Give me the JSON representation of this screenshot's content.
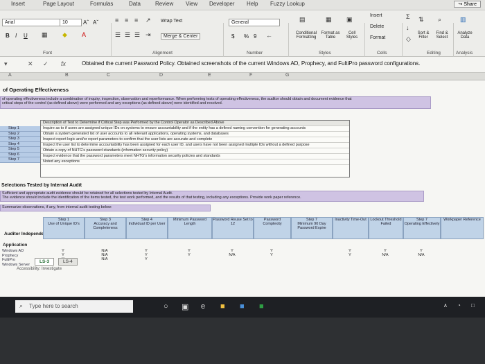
{
  "menubar": {
    "tabs": [
      "Insert",
      "Page Layout",
      "Formulas",
      "Data",
      "Review",
      "View",
      "Developer",
      "Help",
      "Fuzzy Lookup"
    ],
    "share": "Share"
  },
  "ribbon": {
    "font_name": "Arial",
    "font_size": "10",
    "font_grow": "Aˆ",
    "font_shrink": "Aˇ",
    "bold": "B",
    "italic": "I",
    "underline": "U",
    "wrap_text": "Wrap Text",
    "merge_center": "Merge & Center",
    "number_format": "General",
    "currency": "$",
    "percent": "%",
    "comma": "9",
    "conditional_formatting": "Conditional Formatting",
    "format_as_table": "Format as Table",
    "cell_styles": "Cell Styles",
    "insert": "Insert",
    "delete": "Delete",
    "format": "Format",
    "sort_filter": "Sort & Filter",
    "find_select": "Find & Select",
    "analyze_data": "Analyze Data",
    "groups": {
      "font": "Font",
      "alignment": "Alignment",
      "number": "Number",
      "styles": "Styles",
      "cells": "Cells",
      "editing": "Editing",
      "analysis": "Analysis"
    }
  },
  "formula_bar": {
    "fx": "fx",
    "text": "Obtained the current Password Policy. Obtained screenshots of the current Windows AD, Prophecy, and FultiPro password configurations."
  },
  "columns": [
    "A",
    "B",
    "C",
    "D",
    "E",
    "F",
    "G"
  ],
  "sheet": {
    "title": "of Operating Effectiveness",
    "intro": "of operating effectiveness include a combination of inquiry, inspection, observation and reperformance. When performing tests of operating effectiveness, the auditor should obtain and document evidence that",
    "intro2": "critical steps of the control (as defined above) were performed and any exceptions (as defined above) were identified and resolved.",
    "description_header": "Description of Test to Determine if Critical Step was Performed by the Control Operator as Described Above",
    "descriptions": [
      "Inquire as to if users are assigned unique IDs on systems to ensure accountability and if the entity has a defined naming convention for generating accounts",
      "Obtain a system generated list of user accounts to all relevant applications, operating systems, and databases",
      "Inspect report logic and/or report parameters to confirm that the user lists are accurate and complete",
      "Inspect the user list to determine accountability has been assigned for each user ID, and users have not been assigned multiple IDs without a defined purpose",
      "Obtain a copy of NHTG's password standards (information security policy)",
      "Inspect evidence that the password parameters meet NHTG's information security policies and standards",
      "Noted any exceptions"
    ],
    "steps": [
      "Step 1",
      "Step 2",
      "Step 3",
      "Step 4",
      "Step 5",
      "Step 6",
      "Step 7"
    ],
    "selections_title": "Selections Tested by Internal Audit",
    "selections_text1": "Sufficient and appropriate audit evidence should be retained for all selections tested by Internal Audit.",
    "selections_text2": "The evidence should include the identification of the items tested, the test work performed, and the results of that testing, including any exceptions. Provide work paper reference.",
    "summarize": "Summarize observations, if any, from internal audit testing below:",
    "table_title": "Auditor Independent Testing",
    "table_headers": [
      "Application",
      "Use of Unique ID's",
      "Accuracy and Completeness",
      "Individual ID per User",
      "Minimum Password Length",
      "Password Reuse Set to 12",
      "Password Complexity",
      "Minimum 90 Day Password Expire",
      "Inactivity Time-Out",
      "Lockout Threshold Failed",
      "Operating Effectively",
      "Workpaper Reference"
    ],
    "table_step_labels": [
      "Step 2",
      "Step 1",
      "Step 3",
      "Step 4",
      "Step 5",
      "Step 6",
      "Step 7"
    ],
    "rows": [
      {
        "app": "Windows AD",
        "vals": [
          "Y",
          "N/A",
          "Y",
          "Y",
          "Y",
          "Y",
          "Y",
          "Y",
          "Y"
        ]
      },
      {
        "app": "Prophecy",
        "vals": [
          "Y",
          "N/A",
          "Y",
          "Y",
          "N/A",
          "Y",
          "Y",
          "N/A",
          "N/A"
        ]
      },
      {
        "app": "FultiPro",
        "vals": [
          "Y",
          "N/A",
          "Y",
          "",
          "",
          "",
          "",
          "",
          ""
        ]
      },
      {
        "app": "Windows Server",
        "vals": [
          "",
          "",
          "",
          "",
          "",
          "",
          "",
          "",
          ""
        ]
      }
    ],
    "row_numbers": [
      "97",
      "98",
      "99",
      "100",
      "101",
      "102"
    ]
  },
  "sheet_tabs": [
    "LS-3",
    "LS-4"
  ],
  "status": {
    "accessibility": "Accessibility: Investigate"
  },
  "taskbar": {
    "search_placeholder": "Type here to search"
  }
}
